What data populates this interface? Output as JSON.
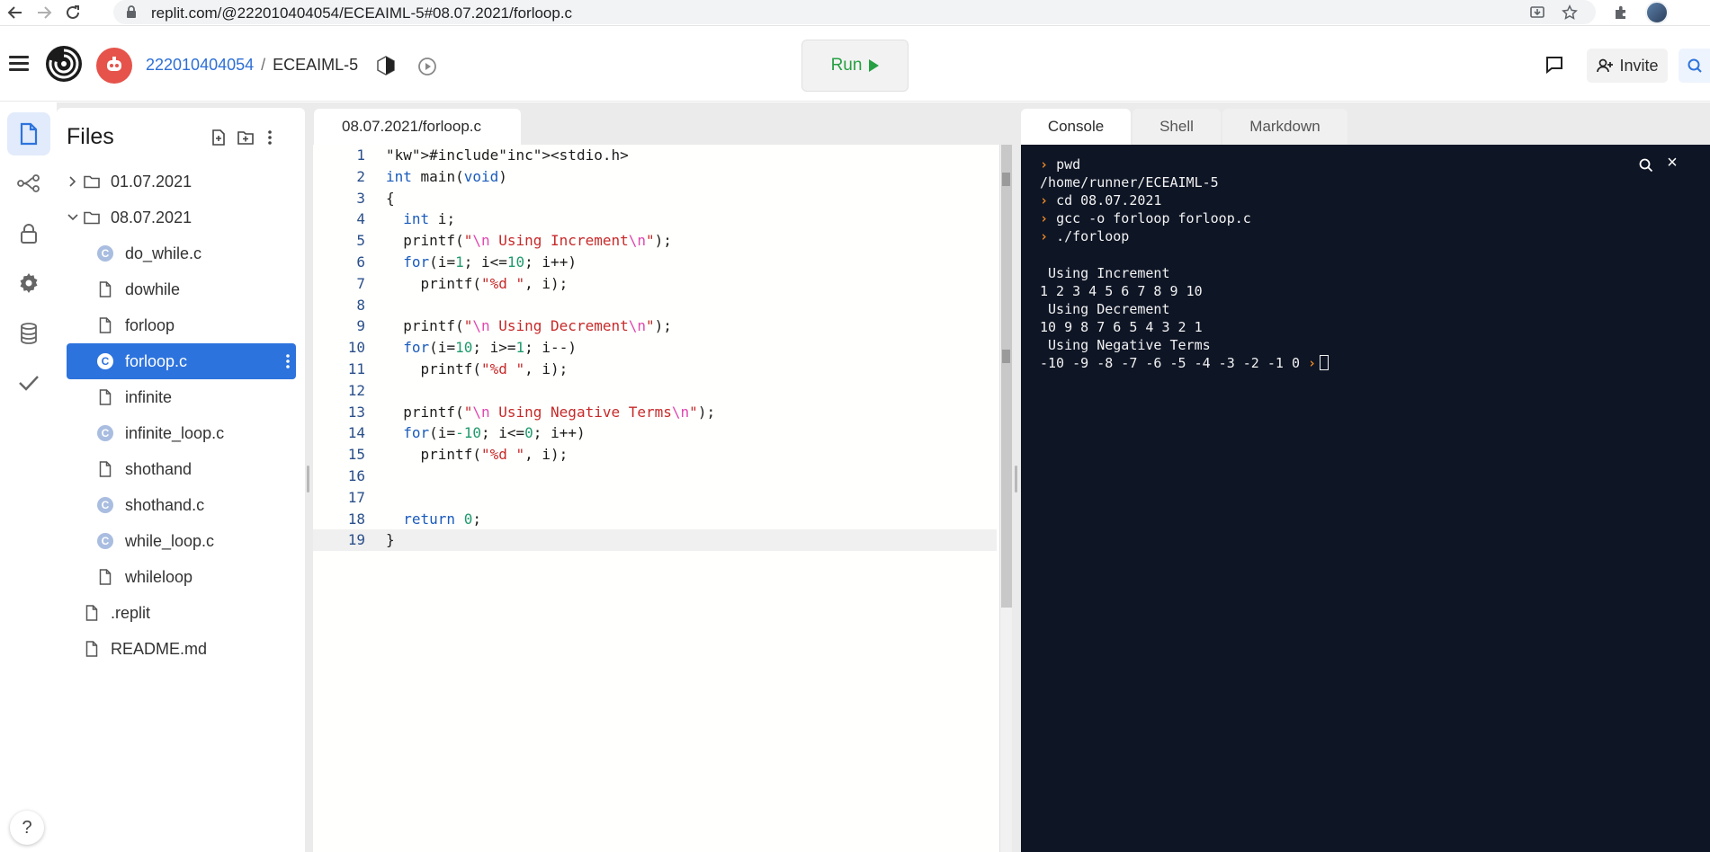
{
  "browser": {
    "url": "replit.com/@222010404054/ECEAIML-5#08.07.2021/forloop.c",
    "icons": [
      "back-arrow-icon",
      "forward-arrow-icon",
      "reload-icon",
      "lock-icon",
      "install-icon",
      "star-icon",
      "extensions-icon",
      "profile-avatar"
    ]
  },
  "header": {
    "username": "222010404054",
    "separator": "/",
    "project": "ECEAIML-5",
    "run_label": "Run",
    "invite_label": "Invite",
    "colors": {
      "run_green": "#26a043",
      "user_blue": "#2d6fd6",
      "avatar_red": "#e5534b"
    }
  },
  "sidebar": {
    "title": "Files",
    "tree": [
      {
        "name": "01.07.2021",
        "type": "folder",
        "expanded": false,
        "depth": 0
      },
      {
        "name": "08.07.2021",
        "type": "folder",
        "expanded": true,
        "depth": 0
      },
      {
        "name": "do_while.c",
        "type": "c-file",
        "depth": 1
      },
      {
        "name": "dowhile",
        "type": "file",
        "depth": 1
      },
      {
        "name": "forloop",
        "type": "file",
        "depth": 1
      },
      {
        "name": "forloop.c",
        "type": "c-file",
        "depth": 1,
        "selected": true
      },
      {
        "name": "infinite",
        "type": "file",
        "depth": 1
      },
      {
        "name": "infinite_loop.c",
        "type": "c-file",
        "depth": 1
      },
      {
        "name": "shothand",
        "type": "file",
        "depth": 1
      },
      {
        "name": "shothand.c",
        "type": "c-file",
        "depth": 1
      },
      {
        "name": "while_loop.c",
        "type": "c-file",
        "depth": 1
      },
      {
        "name": "whileloop",
        "type": "file",
        "depth": 1
      },
      {
        "name": ".replit",
        "type": "file",
        "depth": 0
      },
      {
        "name": "README.md",
        "type": "file",
        "depth": 0
      }
    ],
    "help_label": "?"
  },
  "editor": {
    "tab_label": "08.07.2021/forloop.c",
    "current_line": 19,
    "lines": [
      "#include<stdio.h>",
      "int main(void)",
      "{",
      "  int i;",
      "  printf(\"\\n Using Increment\\n\");",
      "  for(i=1; i<=10; i++)",
      "    printf(\"%d \", i);",
      "",
      "  printf(\"\\n Using Decrement\\n\");",
      "  for(i=10; i>=1; i--)",
      "    printf(\"%d \", i);",
      "",
      "  printf(\"\\n Using Negative Terms\\n\");",
      "  for(i=-10; i<=0; i++)",
      "    printf(\"%d \", i);",
      "",
      "",
      "  return 0;",
      "}"
    ]
  },
  "console": {
    "tabs": [
      "Console",
      "Shell",
      "Markdown"
    ],
    "active_tab": "Console",
    "output": [
      {
        "prompt": true,
        "text": "pwd"
      },
      {
        "prompt": false,
        "text": "/home/runner/ECEAIML-5"
      },
      {
        "prompt": true,
        "text": "cd 08.07.2021"
      },
      {
        "prompt": true,
        "text": "gcc -o forloop forloop.c"
      },
      {
        "prompt": true,
        "text": "./forloop"
      },
      {
        "prompt": false,
        "text": ""
      },
      {
        "prompt": false,
        "text": " Using Increment"
      },
      {
        "prompt": false,
        "text": "1 2 3 4 5 6 7 8 9 10"
      },
      {
        "prompt": false,
        "text": " Using Decrement"
      },
      {
        "prompt": false,
        "text": "10 9 8 7 6 5 4 3 2 1"
      },
      {
        "prompt": false,
        "text": " Using Negative Terms"
      },
      {
        "prompt": false,
        "text": "-10 -9 -8 -7 -6 -5 -4 -3 -2 -1 0 ",
        "trailing_prompt": true,
        "cursor": true
      }
    ],
    "prompt_glyph": "›",
    "close_glyph": "×",
    "colors": {
      "background": "#0e1525",
      "prompt": "#f08a24"
    }
  }
}
